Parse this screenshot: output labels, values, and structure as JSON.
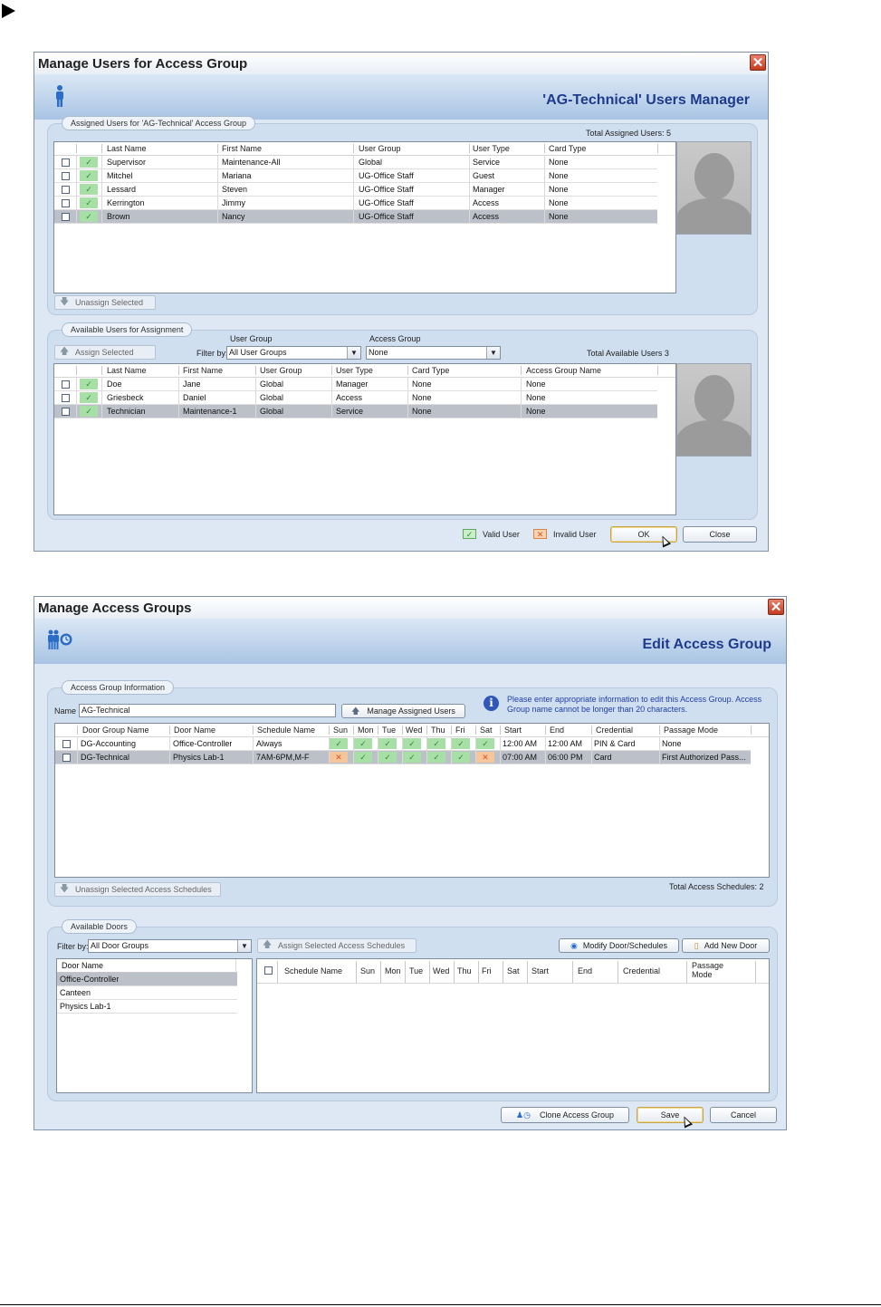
{
  "dialog1": {
    "title": "Manage Users for Access Group",
    "banner_title": "'AG-Technical' Users Manager",
    "assigned": {
      "legend": "Assigned Users for 'AG-Technical' Access Group",
      "total": "Total Assigned Users: 5",
      "columns": [
        "Last Name",
        "First Name",
        "User Group",
        "User Type",
        "Card Type"
      ],
      "rows": [
        {
          "last": "Supervisor",
          "first": "Maintenance-All",
          "group": "Global",
          "type": "Service",
          "card": "None"
        },
        {
          "last": "Mitchel",
          "first": "Mariana",
          "group": "UG-Office Staff",
          "type": "Guest",
          "card": "None"
        },
        {
          "last": "Lessard",
          "first": "Steven",
          "group": "UG-Office Staff",
          "type": "Manager",
          "card": "None"
        },
        {
          "last": "Kerrington",
          "first": "Jimmy",
          "group": "UG-Office Staff",
          "type": "Access",
          "card": "None"
        },
        {
          "last": "Brown",
          "first": "Nancy",
          "group": "UG-Office Staff",
          "type": "Access",
          "card": "None"
        }
      ],
      "unassign_label": "Unassign Selected"
    },
    "available": {
      "legend": "Available Users for Assignment",
      "assign_label": "Assign Selected",
      "filter_label": "Filter by:",
      "user_group_label": "User Group",
      "user_group_value": "All User Groups",
      "access_group_label": "Access Group",
      "access_group_value": "None",
      "total": "Total Available Users 3",
      "columns": [
        "Last Name",
        "First Name",
        "User Group",
        "User Type",
        "Card Type",
        "Access Group Name"
      ],
      "rows": [
        {
          "last": "Doe",
          "first": "Jane",
          "group": "Global",
          "type": "Manager",
          "card": "None",
          "ag": "None"
        },
        {
          "last": "Griesbeck",
          "first": "Daniel",
          "group": "Global",
          "type": "Access",
          "card": "None",
          "ag": "None"
        },
        {
          "last": "Technician",
          "first": "Maintenance-1",
          "group": "Global",
          "type": "Service",
          "card": "None",
          "ag": "None"
        }
      ]
    },
    "valid_label": "Valid User",
    "invalid_label": "Invalid User",
    "ok_label": "OK",
    "close_label": "Close"
  },
  "dialog2": {
    "title": "Manage Access Groups",
    "banner_title": "Edit Access Group",
    "info": {
      "legend": "Access Group Information",
      "name_label": "Name",
      "name_value": "AG-Technical",
      "manage_label": "Manage Assigned Users",
      "hint": "Please enter appropriate information to edit this Access Group. Access Group name cannot be longer than 20 characters.",
      "columns": [
        "Door Group Name",
        "Door Name",
        "Schedule Name",
        "Sun",
        "Mon",
        "Tue",
        "Wed",
        "Thu",
        "Fri",
        "Sat",
        "Start",
        "End",
        "Credential",
        "Passage Mode"
      ],
      "rows": [
        {
          "dg": "DG-Accounting",
          "door": "Office-Controller",
          "sched": "Always",
          "days": [
            1,
            1,
            1,
            1,
            1,
            1,
            1
          ],
          "start": "12:00 AM",
          "end": "12:00 AM",
          "cred": "PIN & Card",
          "mode": "None"
        },
        {
          "dg": "DG-Technical",
          "door": "Physics Lab-1",
          "sched": "7AM-6PM,M-F",
          "days": [
            0,
            1,
            1,
            1,
            1,
            1,
            0
          ],
          "start": "07:00 AM",
          "end": "06:00 PM",
          "cred": "Card",
          "mode": "First Authorized Pass..."
        }
      ],
      "unassign_label": "Unassign Selected Access Schedules",
      "total": "Total Access Schedules: 2"
    },
    "doors": {
      "legend": "Available Doors",
      "filter_label": "Filter by:",
      "filter_value": "All Door Groups",
      "assign_label": "Assign Selected Access Schedules",
      "modify_label": "Modify Door/Schedules",
      "add_label": "Add New Door",
      "list_header": "Door Name",
      "list": [
        "Office-Controller",
        "Canteen",
        "Physics Lab-1"
      ],
      "columns": [
        "Schedule Name",
        "Sun",
        "Mon",
        "Tue",
        "Wed",
        "Thu",
        "Fri",
        "Sat",
        "Start",
        "End",
        "Credential",
        "Passage Mode"
      ]
    },
    "clone_label": "Clone Access Group",
    "save_label": "Save",
    "cancel_label": "Cancel"
  }
}
